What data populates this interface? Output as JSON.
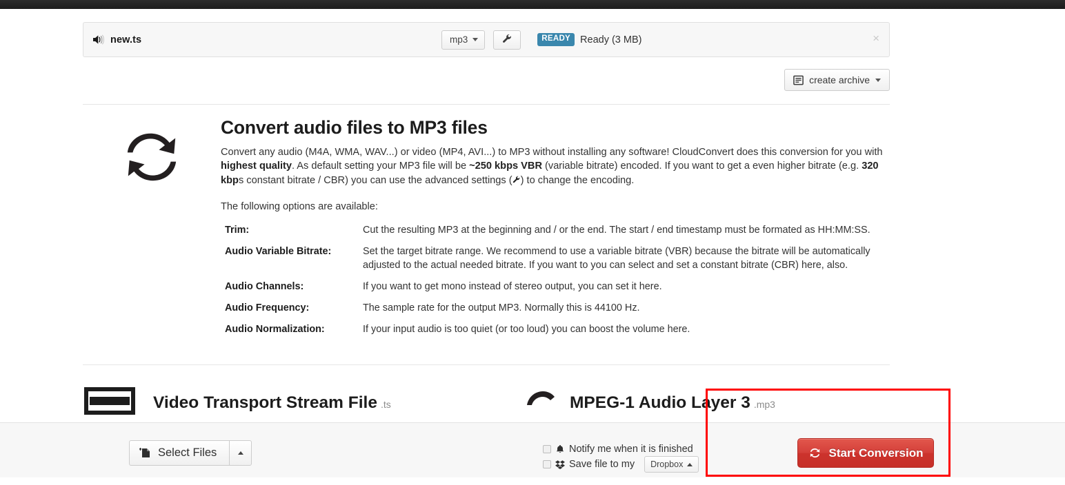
{
  "file_row": {
    "icon": "audio-volume-icon",
    "filename": "new.ts",
    "format_select": {
      "value": "mp3",
      "caret": "chevron-down-icon"
    },
    "settings_icon": "wrench-icon",
    "status_badge": "READY",
    "status_text": "Ready (3 MB)",
    "close": "×"
  },
  "archive": {
    "label": "create archive",
    "icon": "archive-box-icon"
  },
  "info": {
    "icon": "convert-arrows-icon",
    "title": "Convert audio files to MP3 files",
    "lead_parts": [
      {
        "text": "Convert any audio (M4A, WMA, WAV...) or video (MP4, AVI...) to MP3 without installing any software! CloudConvert does this conversion for you with ",
        "bold": false
      },
      {
        "text": "highest quality",
        "bold": true
      },
      {
        "text": ". As default setting your MP3 file will be ",
        "bold": false
      },
      {
        "text": "~250 kbps VBR",
        "bold": true
      },
      {
        "text": " (variable bitrate) encoded. If you want to get a even higher bitrate (e.g. ",
        "bold": false
      },
      {
        "text": "320 kbp",
        "bold": true
      },
      {
        "text": "s constant bitrate / CBR) you can use the advanced settings (",
        "bold": false
      },
      {
        "text": "\u0000wrench",
        "bold": false
      },
      {
        "text": ") to change the encoding.",
        "bold": false
      }
    ],
    "available_text": "The following options are available:",
    "options": [
      {
        "term": "Trim:",
        "desc": "Cut the resulting MP3 at the beginning and / or the end. The start / end timestamp must be formated as HH:MM:SS."
      },
      {
        "term": "Audio Variable Bitrate:",
        "desc": "Set the target bitrate range. We recommend to use a variable bitrate (VBR) because the bitrate will be automatically adjusted to the actual needed bitrate. If you want to you can select and set a constant bitrate (CBR) here, also."
      },
      {
        "term": "Audio Channels:",
        "desc": "If you want to get mono instead of stereo output, you can set it here."
      },
      {
        "term": "Audio Frequency:",
        "desc": "The sample rate for the output MP3. Normally this is 44100 Hz."
      },
      {
        "term": "Audio Normalization:",
        "desc": "If your input audio is too quiet (or too loud) you can boost the volume here."
      }
    ]
  },
  "formats": {
    "source": {
      "icon": "video-file-thumb-icon",
      "title": "Video Transport Stream File",
      "ext": ".ts"
    },
    "arrow_icon": "convert-arrow-icon",
    "target": {
      "title": "MPEG-1 Audio Layer 3",
      "ext": ".mp3"
    }
  },
  "footer": {
    "select_files": {
      "label": "Select Files",
      "icon": "add-file-icon",
      "caret": "chevron-up-icon"
    },
    "notify": {
      "label": "Notify me when it is finished",
      "icon": "bell-icon",
      "checked": false
    },
    "save": {
      "label": "Save file to my",
      "icon": "dropbox-icon",
      "checked": false,
      "target_label": "Dropbox",
      "target_caret": "chevron-up-icon"
    },
    "start": {
      "label": "Start Conversion",
      "icon": "refresh-icon",
      "color": "#cc332d"
    }
  },
  "highlight": {
    "color": "#ff0000"
  }
}
